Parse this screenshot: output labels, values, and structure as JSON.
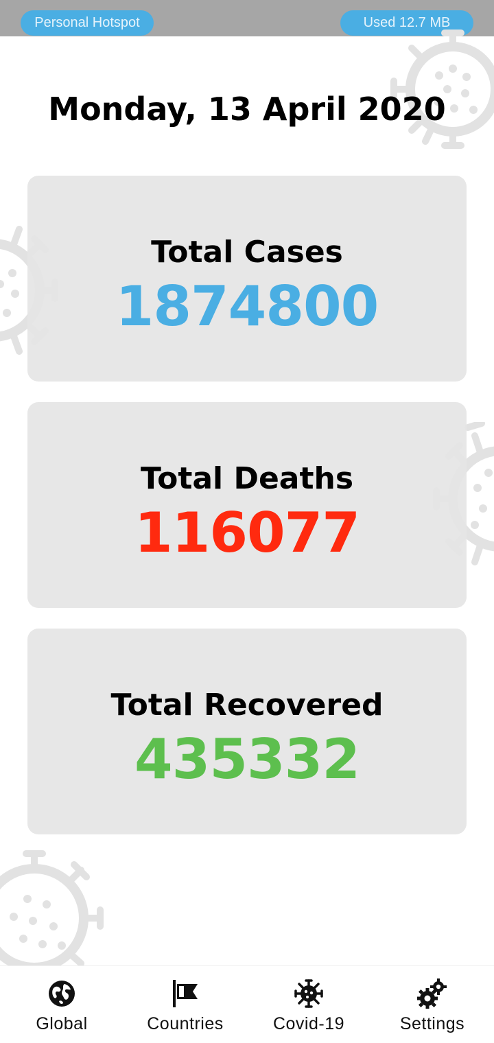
{
  "status_bar": {
    "hotspot_label": "Personal Hotspot",
    "data_used_label": "Used  12.7 MB",
    "pill_color": "#4aaee3"
  },
  "header": {
    "date": "Monday, 13 April 2020"
  },
  "stats": [
    {
      "label": "Total Cases",
      "value": "1874800",
      "color": "#4aaee3"
    },
    {
      "label": "Total Deaths",
      "value": "116077",
      "color": "#ff2a0f"
    },
    {
      "label": "Total Recovered",
      "value": "435332",
      "color": "#5dbf4e"
    }
  ],
  "bottom_nav": {
    "items": [
      {
        "label": "Global",
        "icon": "globe-icon"
      },
      {
        "label": "Countries",
        "icon": "flag-icon"
      },
      {
        "label": "Covid-19",
        "icon": "virus-icon"
      },
      {
        "label": "Settings",
        "icon": "gears-icon"
      }
    ]
  }
}
